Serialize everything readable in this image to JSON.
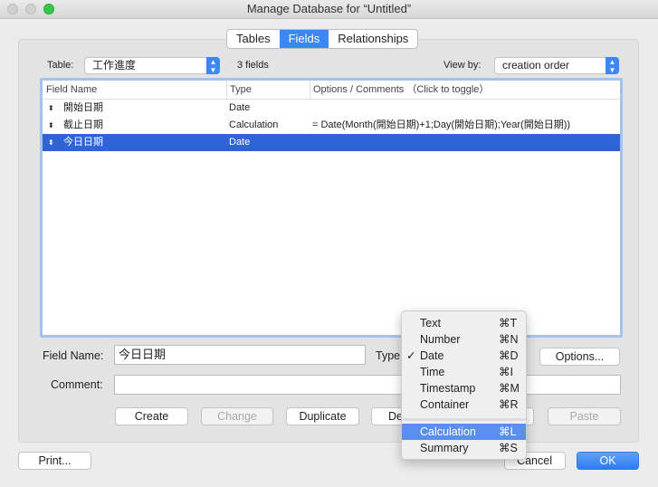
{
  "window": {
    "title": "Manage Database for “Untitled”"
  },
  "tabs": [
    {
      "label": "Tables"
    },
    {
      "label": "Fields",
      "active": true
    },
    {
      "label": "Relationships"
    }
  ],
  "table_label": "Table:",
  "table_value": "工作進度",
  "field_count": "3 fields",
  "viewby_label": "View by:",
  "viewby_value": "creation order",
  "columns": [
    "Field Name",
    "Type",
    "Options / Comments （Click to toggle）"
  ],
  "rows": [
    {
      "name": "開始日期",
      "type": "Date",
      "options": ""
    },
    {
      "name": "截止日期",
      "type": "Calculation",
      "options": "= Date(Month(開始日期)+1;Day(開始日期);Year(開始日期))"
    },
    {
      "name": "今日日期",
      "type": "Date",
      "options": "",
      "selected": true
    }
  ],
  "field_name_label": "Field Name:",
  "field_name_value": "今日日期",
  "type_label": "Type",
  "options_button": "Options...",
  "comment_label": "Comment:",
  "comment_value": "",
  "buttons": {
    "create": "Create",
    "change": "Change",
    "duplicate": "Duplicate",
    "delete": "De",
    "paste": "Paste",
    "print": "Print...",
    "cancel": "Cancel",
    "ok": "OK"
  },
  "type_menu": [
    {
      "label": "Text",
      "key": "⌘T"
    },
    {
      "label": "Number",
      "key": "⌘N"
    },
    {
      "label": "Date",
      "key": "⌘D",
      "checked": true
    },
    {
      "label": "Time",
      "key": "⌘I"
    },
    {
      "label": "Timestamp",
      "key": "⌘M"
    },
    {
      "label": "Container",
      "key": "⌘R"
    },
    {
      "label": "Calculation",
      "key": "⌘L",
      "highlighted": true
    },
    {
      "label": "Summary",
      "key": "⌘S"
    }
  ],
  "colors": {
    "accent": "#3b87f5",
    "selection": "#2f64d6",
    "menu_highlight": "#5a8ff0"
  }
}
